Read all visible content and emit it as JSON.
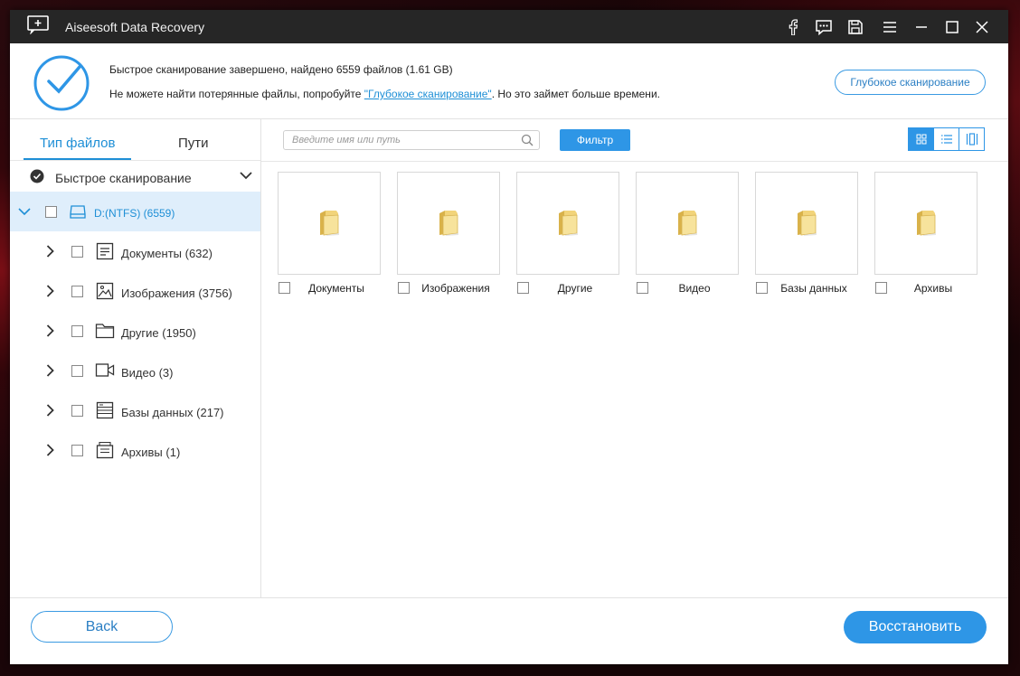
{
  "window": {
    "title": "Aiseesoft Data Recovery",
    "controls": [
      "facebook-icon",
      "feedback-icon",
      "save-icon",
      "menu-icon",
      "minimize-icon",
      "maximize-icon",
      "close-icon"
    ]
  },
  "banner": {
    "status_line": "Быстрое сканирование завершено, найдено 6559 файлов (1.61 GB)",
    "hint_prefix": "Не можете найти потерянные файлы, попробуйте ",
    "hint_link": "\"Глубокое сканирование\"",
    "hint_suffix": ". Но это займет больше времени.",
    "deep_scan_button": "Глубокое сканирование",
    "accent_color": "#2e96e6"
  },
  "sidebar": {
    "tabs": [
      {
        "label": "Тип файлов",
        "active": true
      },
      {
        "label": "Пути",
        "active": false
      }
    ],
    "scan_mode": "Быстрое сканирование",
    "drive": {
      "label": "D:(NTFS) (6559)",
      "expanded": true,
      "checked": false
    },
    "categories": [
      {
        "label": "Документы (632)",
        "icon": "document-icon"
      },
      {
        "label": "Изображения (3756)",
        "icon": "image-icon"
      },
      {
        "label": "Другие (1950)",
        "icon": "folder-icon"
      },
      {
        "label": "Видео (3)",
        "icon": "video-icon"
      },
      {
        "label": "Базы данных (217)",
        "icon": "database-icon"
      },
      {
        "label": "Архивы (1)",
        "icon": "archive-icon"
      }
    ]
  },
  "toolbar": {
    "search_placeholder": "Введите имя или путь",
    "filter_button": "Фильтр",
    "view_modes": [
      "grid-view-icon",
      "list-view-icon",
      "preview-view-icon"
    ],
    "active_view": "grid-view-icon"
  },
  "grid": {
    "items": [
      {
        "label": "Документы"
      },
      {
        "label": "Изображения"
      },
      {
        "label": "Другие"
      },
      {
        "label": "Видео"
      },
      {
        "label": "Базы данных"
      },
      {
        "label": "Архивы"
      }
    ]
  },
  "footer": {
    "back_button": "Back",
    "restore_button": "Восстановить"
  }
}
